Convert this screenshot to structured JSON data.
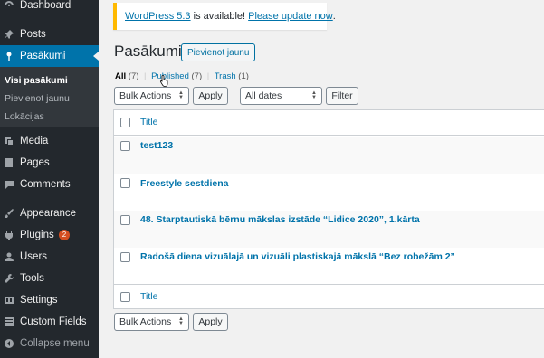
{
  "sidebar": {
    "items": [
      {
        "label": "Dashboard",
        "icon": "dashboard-icon"
      },
      {
        "label": "Posts",
        "icon": "pin-icon"
      },
      {
        "label": "Pasākumi",
        "icon": "pin-icon"
      },
      {
        "label": "Media",
        "icon": "media-icon"
      },
      {
        "label": "Pages",
        "icon": "page-icon"
      },
      {
        "label": "Comments",
        "icon": "comment-icon"
      },
      {
        "label": "Appearance",
        "icon": "brush-icon"
      },
      {
        "label": "Plugins",
        "icon": "plug-icon",
        "badge": "2"
      },
      {
        "label": "Users",
        "icon": "user-icon"
      },
      {
        "label": "Tools",
        "icon": "wrench-icon"
      },
      {
        "label": "Settings",
        "icon": "settings-icon"
      },
      {
        "label": "Custom Fields",
        "icon": "grid-icon"
      },
      {
        "label": "Collapse menu",
        "icon": "collapse-icon"
      }
    ],
    "submenu": [
      "Visi pasākumi",
      "Pievienot jaunu",
      "Lokācijas"
    ]
  },
  "notice": {
    "link1": "WordPress 5.3",
    "middle": " is available! ",
    "link2": "Please update now",
    "end": "."
  },
  "page": {
    "title": "Pasākumi",
    "add_new": "Pievienot jaunu"
  },
  "filters": {
    "all": "All",
    "all_count": " (7)",
    "published": "Published",
    "published_count": " (7)",
    "trash": "Trash",
    "trash_count": " (1)",
    "sep": "|"
  },
  "controls": {
    "bulk_actions": "Bulk Actions",
    "apply": "Apply",
    "dates": "All dates",
    "filter": "Filter"
  },
  "table": {
    "header_title": "Title",
    "footer_title": "Title",
    "rows": [
      "test123",
      "Freestyle sestdiena",
      "48. Starptautiskā bērnu mākslas izstāde “Lidice 2020”, 1.kārta",
      "Radošā diena vizuālajā un vizuāli plastiskajā mākslā “Bez robežām 2”"
    ]
  },
  "colors": {
    "sidebar": "#23282d",
    "active": "#0073aa",
    "link": "#0073aa",
    "notice_border": "#ffb900",
    "badge": "#d54e21"
  }
}
